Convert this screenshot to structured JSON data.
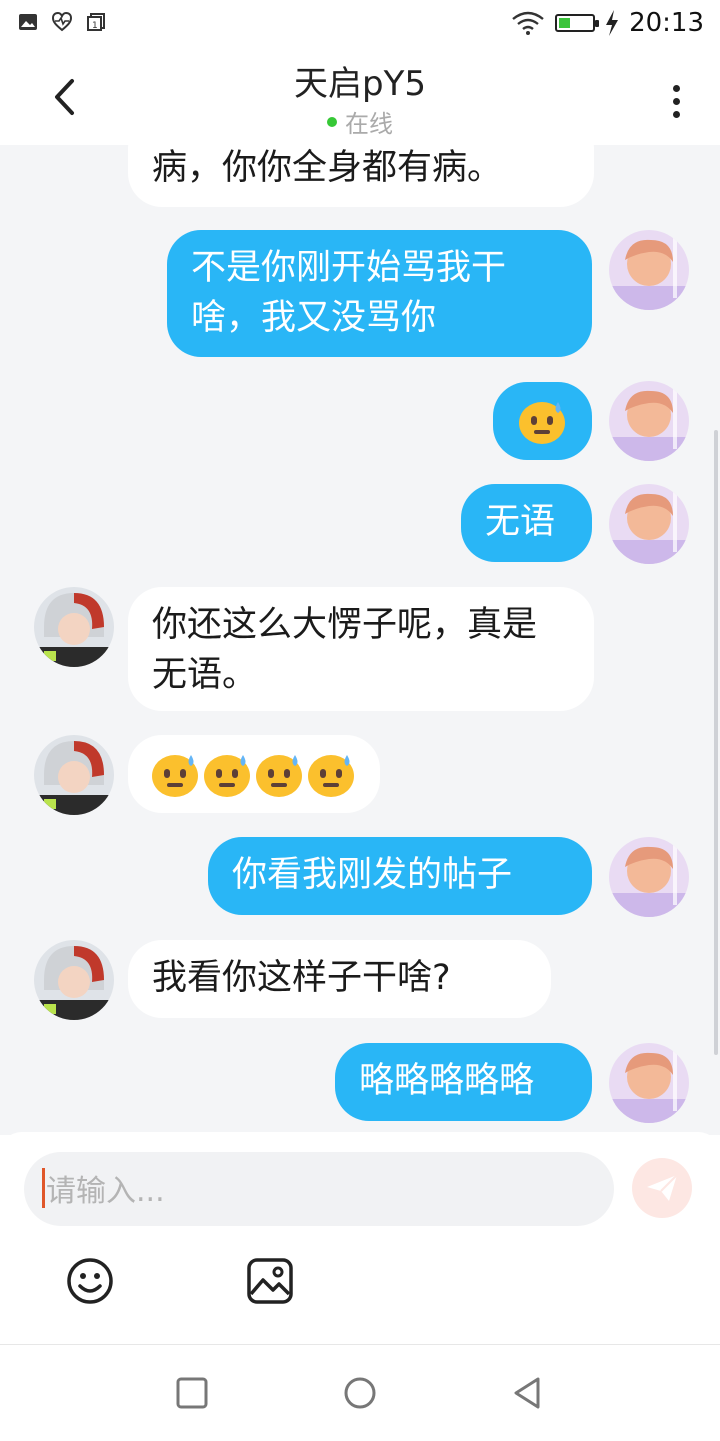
{
  "status_bar": {
    "time": "20:13",
    "battery_percent": 0.35
  },
  "header": {
    "title": "天启pY5",
    "online_status": "在线"
  },
  "messages": [
    {
      "side": "in",
      "text": "病，你你全身都有病。"
    },
    {
      "side": "out",
      "text": "不是你刚开始骂我干啥，我又没骂你"
    },
    {
      "side": "out",
      "emoji": [
        "sweat-smile-neutral-emoji"
      ]
    },
    {
      "side": "out",
      "text": "无语"
    },
    {
      "side": "in",
      "text": "你还这么大愣子呢，真是无语。"
    },
    {
      "side": "in",
      "emoji": [
        "sweat-smile-neutral-emoji",
        "sweat-smile-neutral-emoji",
        "sweat-smile-neutral-emoji",
        "sweat-smile-neutral-emoji"
      ]
    },
    {
      "side": "out",
      "text": "你看我刚发的帖子"
    },
    {
      "side": "in",
      "text": "我看你这样子干啥?"
    },
    {
      "side": "out",
      "text": "略略略略略"
    }
  ],
  "composer": {
    "placeholder": "请输入..."
  },
  "colors": {
    "out_bubble": "#29b6f6",
    "in_bubble": "#ffffff",
    "online_dot": "#36c836",
    "send_button": "#fde7e3"
  }
}
